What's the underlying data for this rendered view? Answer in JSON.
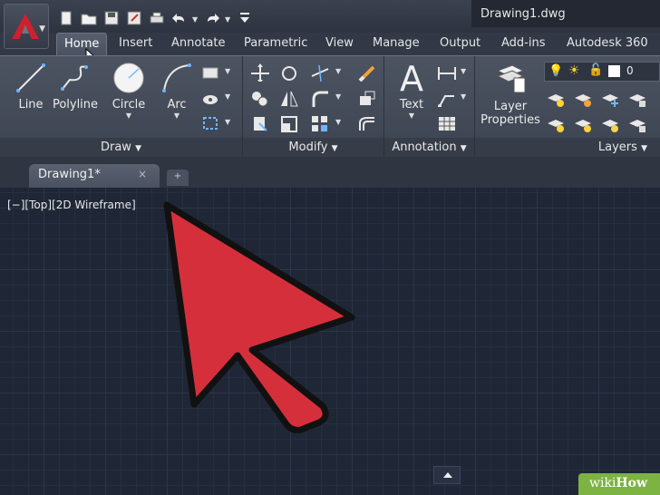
{
  "app": {
    "document_title": "Drawing1.dwg",
    "logo_icon": "autocad-a-logo"
  },
  "quick_access": [
    "new-icon",
    "open-icon",
    "save-icon",
    "save-as-icon",
    "print-icon",
    "undo-icon",
    "redo-icon",
    "customize-icon"
  ],
  "ribbon_tabs": [
    "Home",
    "Insert",
    "Annotate",
    "Parametric",
    "View",
    "Manage",
    "Output",
    "Add-ins",
    "Autodesk 360"
  ],
  "panels": {
    "draw": {
      "title": "Draw",
      "tools": [
        "Line",
        "Polyline",
        "Circle",
        "Arc"
      ]
    },
    "modify": {
      "title": "Modify"
    },
    "annotation": {
      "title": "Annotation",
      "tools": [
        "Text"
      ]
    },
    "layers": {
      "title": "Layers",
      "tool_line1": "Layer",
      "tool_line2": "Properties",
      "current_layer": "0"
    }
  },
  "document_tab": {
    "label": "Drawing1*",
    "close": "×",
    "new_tab": "+"
  },
  "viewport": {
    "label": "[−][Top][2D Wireframe]"
  },
  "watermark": {
    "prefix": "wiki",
    "suffix": "How"
  },
  "colors": {
    "accent_red": "#d62f3c",
    "background": "#1f2636"
  }
}
